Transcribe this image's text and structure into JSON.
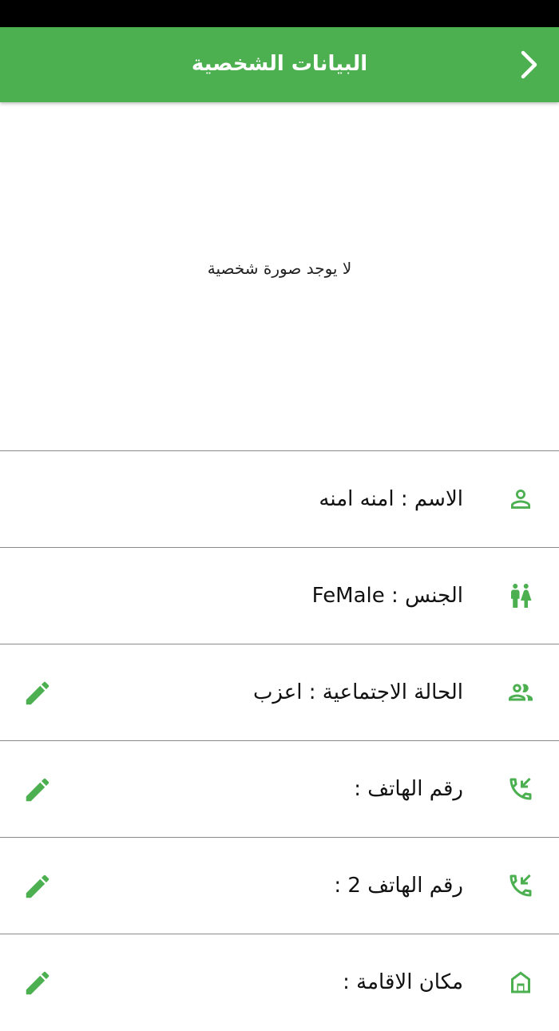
{
  "header": {
    "title": "البيانات الشخصية",
    "back_icon": "chevron-right-icon",
    "color": "#4caf50"
  },
  "photo": {
    "placeholder_text": "لا يوجد صورة شخصية"
  },
  "rows": [
    {
      "label": "الاسم",
      "separator": ":",
      "value": "امنه امنه",
      "icon": "person-icon",
      "editable": false
    },
    {
      "label": "الجنس",
      "separator": ":",
      "value": "FeMale",
      "icon": "wc-icon",
      "editable": false
    },
    {
      "label": "الحالة الاجتماعية",
      "separator": ":",
      "value": "اعزب",
      "icon": "people-icon",
      "editable": true
    },
    {
      "label": "رقم الهاتف",
      "separator": ":",
      "value": "",
      "icon": "phone-callback-icon",
      "editable": true
    },
    {
      "label": "رقم الهاتف 2",
      "separator": ":",
      "value": "",
      "icon": "phone-callback-icon",
      "editable": true
    },
    {
      "label": "مكان الاقامة",
      "separator": ":",
      "value": "",
      "icon": "home-icon",
      "editable": true
    }
  ]
}
